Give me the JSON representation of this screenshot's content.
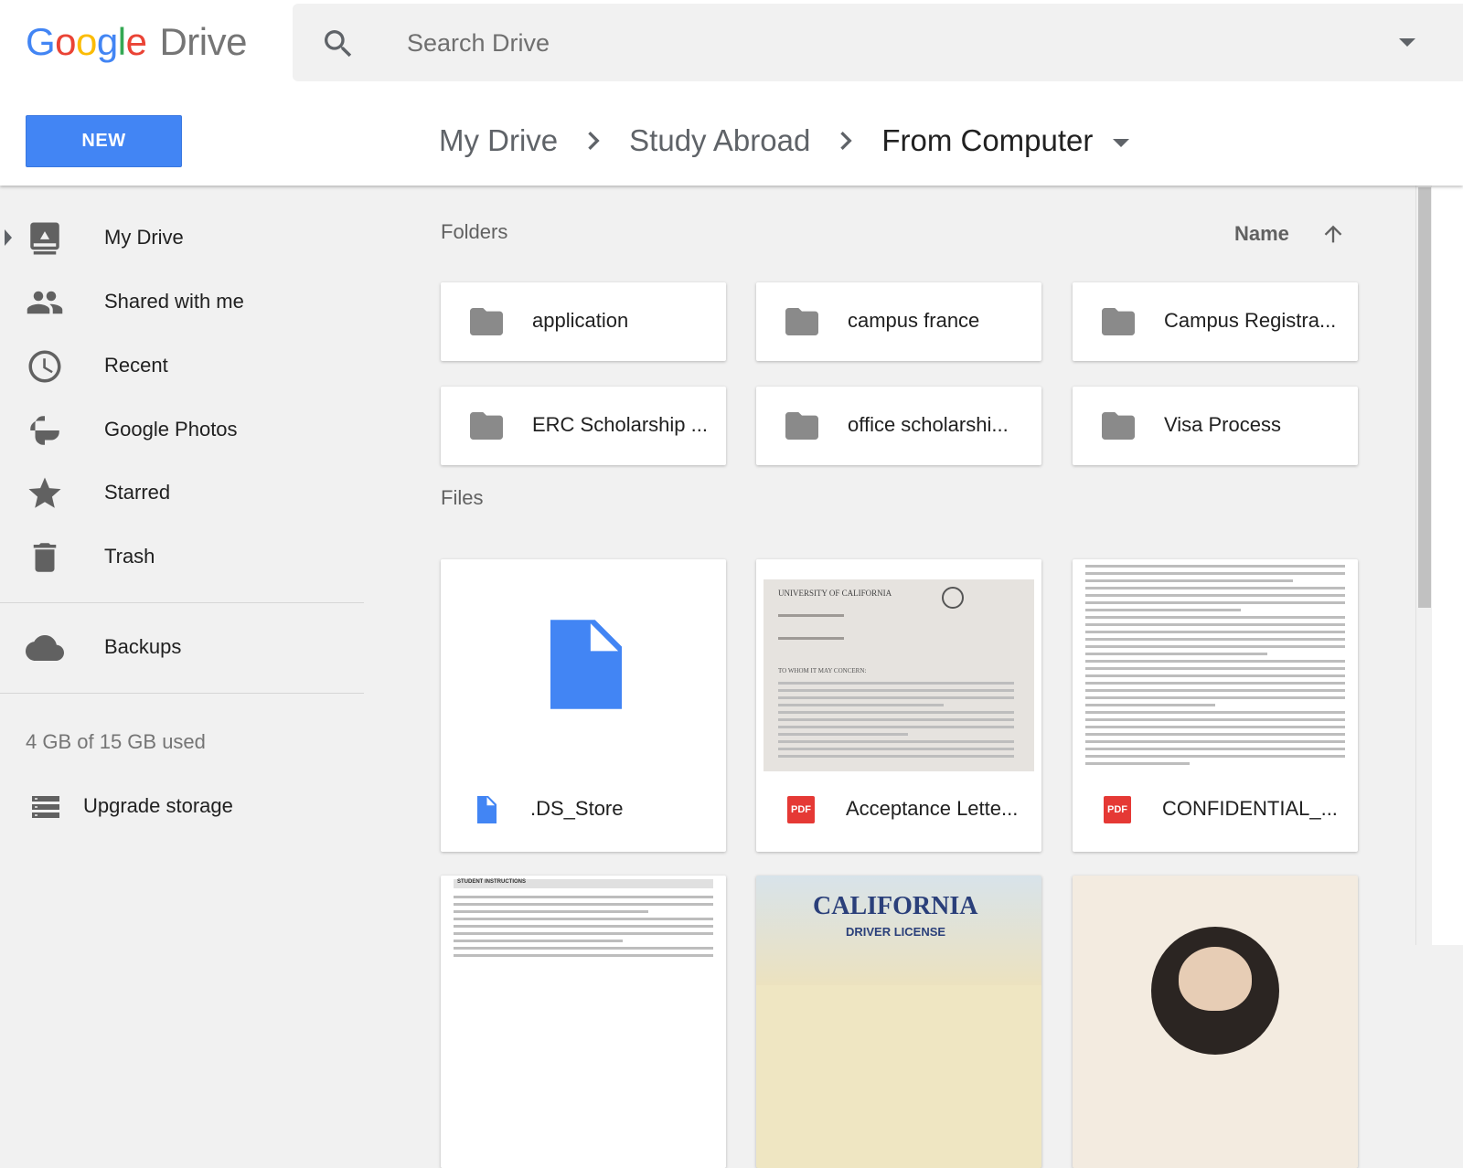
{
  "logo": {
    "google": [
      "G",
      "o",
      "o",
      "g",
      "l",
      "e"
    ],
    "product": "Drive"
  },
  "search": {
    "placeholder": "Search Drive"
  },
  "toolbar": {
    "new_label": "NEW"
  },
  "breadcrumb": {
    "items": [
      "My Drive",
      "Study Abroad"
    ],
    "current": "From Computer"
  },
  "sidebar": {
    "items": [
      {
        "label": "My Drive",
        "icon": "my-drive-icon"
      },
      {
        "label": "Shared with me",
        "icon": "people-icon"
      },
      {
        "label": "Recent",
        "icon": "clock-icon"
      },
      {
        "label": "Google Photos",
        "icon": "pinwheel-icon"
      },
      {
        "label": "Starred",
        "icon": "star-icon"
      },
      {
        "label": "Trash",
        "icon": "trash-icon"
      }
    ],
    "backups": {
      "label": "Backups",
      "icon": "cloud-icon"
    },
    "quota": "4 GB of 15 GB used",
    "upgrade": {
      "label": "Upgrade storage",
      "icon": "storage-icon"
    }
  },
  "main": {
    "folders_label": "Folders",
    "files_label": "Files",
    "sort": {
      "label": "Name",
      "direction": "ascending"
    },
    "folders": [
      "application",
      "campus france",
      "Campus Registra...",
      "ERC Scholarship ...",
      "office scholarshi...",
      "Visa Process"
    ],
    "files": [
      {
        "name": ".DS_Store",
        "type": "doc"
      },
      {
        "name": "Acceptance Lette...",
        "type": "pdf",
        "thumb_text": [
          "UNIVERSITY OF CALIFORNIA",
          "TO WHOM IT MAY CONCERN:"
        ]
      },
      {
        "name": "CONFIDENTIAL_...",
        "type": "pdf"
      }
    ],
    "bottom_row_thumbs": [
      "STUDENT INSTRUCTIONS",
      "CALIFORNIA",
      "DRIVER LICENSE"
    ],
    "pdf_badge": "PDF"
  },
  "colors": {
    "accent": "#4285f4",
    "pdf": "#e53935",
    "folder": "#8a8a8a"
  }
}
